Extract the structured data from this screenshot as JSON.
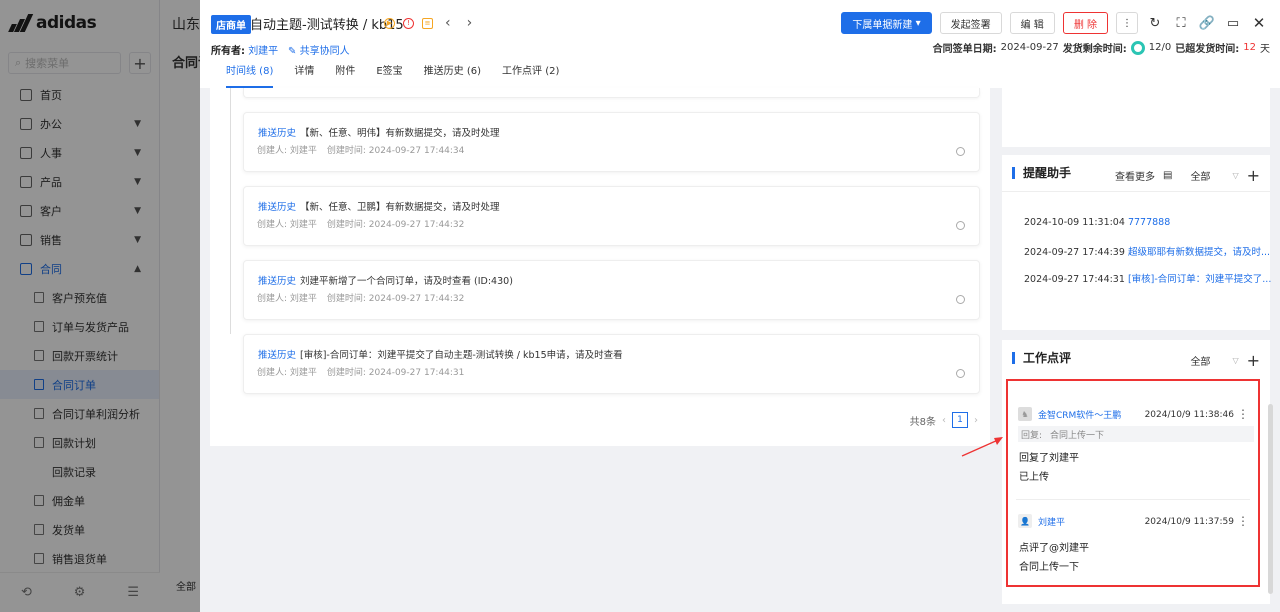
{
  "brand": {
    "logo": "adidas"
  },
  "sidebar": {
    "search_placeholder": "搜索菜单",
    "items": [
      {
        "label": "首页",
        "expandable": false
      },
      {
        "label": "办公",
        "expandable": true
      },
      {
        "label": "人事",
        "expandable": true
      },
      {
        "label": "产品",
        "expandable": true
      },
      {
        "label": "客户",
        "expandable": true
      },
      {
        "label": "销售",
        "expandable": true
      },
      {
        "label": "合同",
        "expandable": true,
        "open": true
      }
    ],
    "sub_items": [
      "客户预充值",
      "订单与发货产品",
      "回款开票统计",
      "合同订单",
      "合同订单利润分析",
      "回款计划",
      "回款记录",
      "佣金单",
      "发货单",
      "销售退货单"
    ],
    "active_sub": "合同订单"
  },
  "background": {
    "title": "山东",
    "subtitle": "合同订",
    "button": "全部"
  },
  "drawer": {
    "tag": "店商单",
    "title": "自动主题-测试转换 / kb15",
    "owner_label": "所有者:",
    "owner_name": "刘建平",
    "share_label": "共享协同人",
    "buttons": {
      "new_sub": "下属单据新建",
      "sign": "发起签署",
      "edit": "编 辑",
      "delete": "删 除"
    },
    "dates": {
      "sign_label": "合同签单日期:",
      "sign_date": "2024-09-27",
      "remain_label": "发货剩余时间:",
      "remain_value": "12/0",
      "overdue_label": "已超发货时间:",
      "overdue_value": "12",
      "overdue_unit": "天"
    },
    "tabs": [
      "时间线 (8)",
      "详情",
      "附件",
      "E签宝",
      "推送历史 (6)",
      "工作点评 (2)"
    ],
    "active_tab": "时间线 (8)"
  },
  "timeline": {
    "cards": [
      {
        "type": "推送历史",
        "text": "【新、任意、明伟】有新数据提交，请及时处理",
        "creator": "创建人: 刘建平",
        "time": "创建时间: 2024-09-27 17:44:34"
      },
      {
        "type": "推送历史",
        "text": "【新、任意、卫鹏】有新数据提交，请及时处理",
        "creator": "创建人: 刘建平",
        "time": "创建时间: 2024-09-27 17:44:32"
      },
      {
        "type": "推送历史",
        "text": "刘建平新增了一个合同订单，请及时查看 (ID:430)",
        "creator": "创建人: 刘建平",
        "time": "创建时间: 2024-09-27 17:44:32"
      },
      {
        "type": "推送历史",
        "text": "[审核]-合同订单：刘建平提交了自动主题-测试转换 / kb15申请，请及时查看",
        "creator": "创建人: 刘建平",
        "time": "创建时间: 2024-09-27 17:44:31"
      }
    ],
    "total": "共8条",
    "page": "1"
  },
  "reminder": {
    "title": "提醒助手",
    "more": "查看更多",
    "filter": "全部",
    "items": [
      {
        "time": "2024-10-09 11:31:04",
        "text": "7777888"
      },
      {
        "time": "2024-09-27 17:44:39",
        "text": "超级耶耶有新数据提交，请及时..."
      },
      {
        "time": "2024-09-27 17:44:31",
        "text": "[审核]-合同订单：刘建平提交了..."
      }
    ]
  },
  "comments": {
    "title": "工作点评",
    "filter": "全部",
    "items": [
      {
        "author": "金智CRM软件～王鹏",
        "time": "2024/10/9 11:38:46",
        "reply_label": "回复:",
        "reply_text": "合同上传一下",
        "lines": [
          "回复了刘建平",
          "已上传"
        ]
      },
      {
        "author": "刘建平",
        "time": "2024/10/9 11:37:59",
        "lines": [
          "点评了@刘建平",
          "合同上传一下"
        ]
      }
    ]
  },
  "colors": {
    "accent": "#1e6ee8",
    "danger": "#e33333",
    "ring": "#2bc5b4"
  }
}
